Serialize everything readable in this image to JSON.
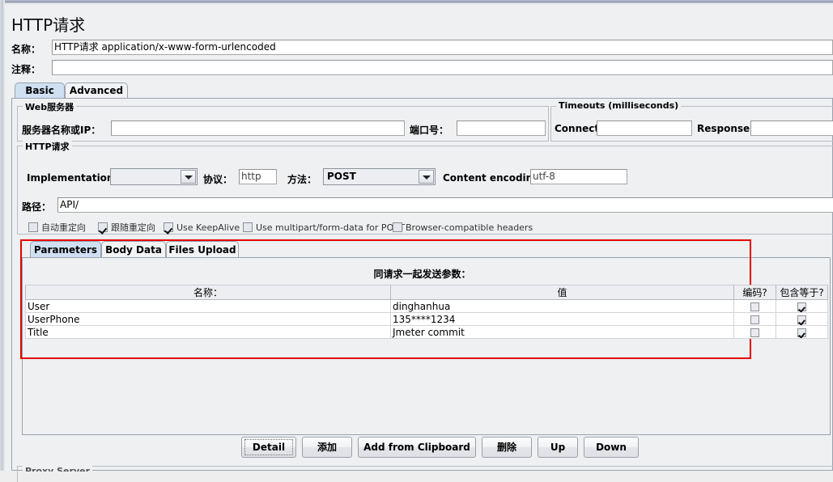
{
  "window": {
    "title": "HTTP请求"
  },
  "header": {
    "name_label": "名称：",
    "name_value": "HTTP请求  application/x-www-form-urlencoded",
    "comment_label": "注释：",
    "comment_value": ""
  },
  "tabs": [
    {
      "label": "Basic",
      "selected": true
    },
    {
      "label": "Advanced",
      "selected": false
    }
  ],
  "web_server": {
    "group_title": "Web服务器",
    "server_label": "服务器名称或IP：",
    "server_value": "",
    "port_label": "端口号：",
    "port_value": ""
  },
  "timeouts": {
    "group_title": "Timeouts (milliseconds)",
    "connect_label": "Connect:",
    "connect_value": "",
    "response_label": "Response:",
    "response_value": ""
  },
  "http_request": {
    "group_title": "HTTP请求",
    "implementation_label": "Implementation:",
    "implementation_value": "",
    "protocol_label": "协议：",
    "protocol_value": "http",
    "method_label": "方法：",
    "method_value": "POST",
    "content_encoding_label": "Content encoding:",
    "content_encoding_value": "utf-8",
    "path_label": "路径：",
    "path_value": "API/"
  },
  "options": [
    {
      "label": "自动重定向",
      "checked": false
    },
    {
      "label": "跟随重定向",
      "checked": true
    },
    {
      "label": "Use KeepAlive",
      "checked": true
    },
    {
      "label": "Use multipart/form-data for POST",
      "checked": false
    },
    {
      "label": "Browser-compatible headers",
      "checked": false
    }
  ],
  "inner_tabs": [
    {
      "label": "Parameters",
      "selected": true
    },
    {
      "label": "Body Data",
      "selected": false
    },
    {
      "label": "Files Upload",
      "selected": false
    }
  ],
  "parameters": {
    "section_label": "同请求一起发送参数：",
    "columns": [
      "名称：",
      "值",
      "编码?",
      "包含等于?"
    ],
    "rows": [
      {
        "name": "User",
        "value": "dinghanhua",
        "encode": false,
        "include_equals": true
      },
      {
        "name": "UserPhone",
        "value": "135****1234",
        "encode": false,
        "include_equals": true
      },
      {
        "name": "Title",
        "value": "Jmeter commit",
        "encode": false,
        "include_equals": true
      }
    ]
  },
  "buttons": [
    {
      "label": "Detail",
      "focused": true
    },
    {
      "label": "添加",
      "focused": false
    },
    {
      "label": "Add from Clipboard",
      "focused": false
    },
    {
      "label": "删除",
      "focused": false
    },
    {
      "label": "Up",
      "focused": false
    },
    {
      "label": "Down",
      "focused": false
    }
  ],
  "proxy_server": {
    "group_title": "Proxy Server"
  },
  "colors": {
    "highlight_red": "#e60000",
    "tab_selected": "#cfe0f2",
    "panel_bg": "#eef0f2"
  }
}
